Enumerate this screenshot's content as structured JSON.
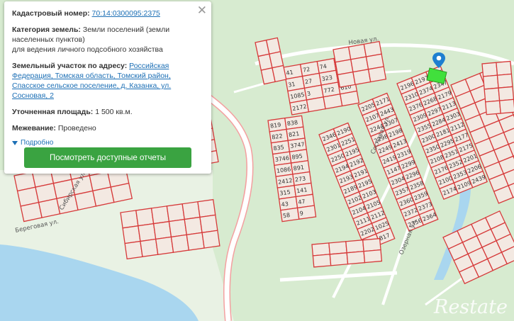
{
  "popup": {
    "cadastral_number_label": "Кадастровый номер:",
    "cadastral_number_value": "70:14:0300095:2375",
    "category_label": "Категория земель:",
    "category_value": "Земли поселений (земли населенных пунктов)",
    "category_value_line2": "для ведения личного подсобного хозяйства",
    "address_label": "Земельный участок по адресу:",
    "address_value": "Российская Федерация, Томская область, Томский район, Спасское сельское поселение, д. Казанка, ул. Сосновая, 2",
    "area_label": "Уточненная площадь:",
    "area_value": "1 500 кв.м.",
    "survey_label": "Межевание:",
    "survey_value": "Проведено",
    "details_link": "Подробно",
    "reports_button": "Посмотреть доступные отчеты",
    "close_icon": "close-icon"
  },
  "map": {
    "street_labels": [
      "Новая ул.",
      "Сосновая ул.",
      "Озерная ул.",
      "Сибирская ул.",
      "Береговая ул."
    ],
    "plot_numbers": [
      "2196",
      "2197",
      "2305",
      "2310",
      "2374",
      "2347",
      "2376",
      "2268",
      "2179",
      "2309",
      "2297",
      "2113",
      "2355",
      "2284",
      "2303",
      "2300",
      "2181",
      "2112",
      "2350",
      "2295",
      "2177",
      "2108",
      "2351",
      "2175",
      "2176",
      "2352",
      "2201",
      "2100",
      "2353",
      "2206",
      "2174",
      "2109",
      "2439",
      "2205",
      "2171",
      "2107",
      "2443",
      "2244",
      "2307",
      "2298",
      "2198",
      "2249",
      "2413",
      "2419",
      "2319",
      "1147",
      "2299",
      "2304",
      "2296",
      "2357",
      "2358",
      "2360",
      "2359",
      "2372",
      "2373",
      "2356",
      "2364",
      "2346",
      "2190",
      "2301",
      "2251",
      "2250",
      "2195",
      "2194",
      "2192",
      "2193",
      "2191",
      "2189",
      "2195",
      "2102",
      "2103",
      "2104",
      "2105",
      "2111",
      "2112",
      "2202",
      "1025",
      "824",
      "817",
      "819",
      "838",
      "822",
      "821",
      "835",
      "3747",
      "3746",
      "895",
      "1086",
      "891",
      "2412",
      "273",
      "315",
      "141",
      "43",
      "47",
      "58",
      "9",
      "41",
      "72",
      "74",
      "46",
      "31",
      "27",
      "323",
      "1078",
      "1085",
      "3",
      "772",
      "610",
      "2172"
    ],
    "watermark": "Restate",
    "marker_icon": "location-pin-icon"
  }
}
